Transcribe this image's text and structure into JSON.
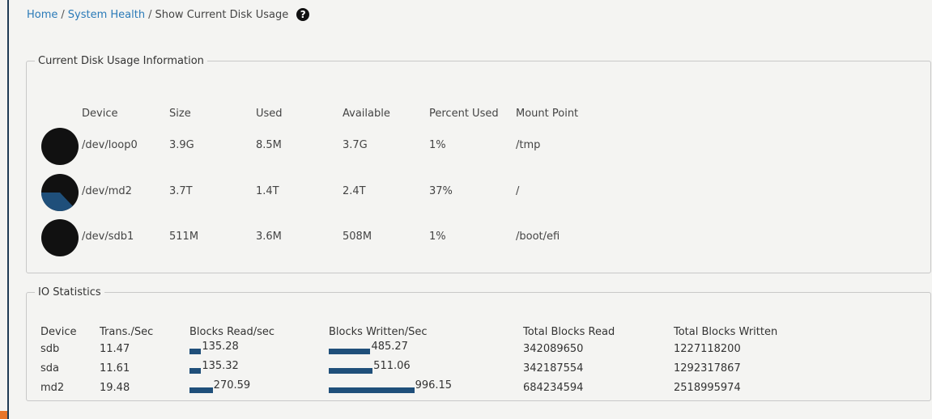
{
  "breadcrumb": {
    "home": "Home",
    "sep1": "/",
    "system_health": "System Health",
    "sep2": "/",
    "current": "Show Current Disk Usage",
    "help_glyph": "?"
  },
  "disk_usage": {
    "legend": "Current Disk Usage Information",
    "columns": [
      "Device",
      "Size",
      "Used",
      "Available",
      "Percent Used",
      "Mount Point"
    ],
    "rows": [
      {
        "device": "/dev/loop0",
        "size": "3.9G",
        "used": "8.5M",
        "available": "3.7G",
        "percent": "1%",
        "percent_value": 1,
        "mount": "/tmp"
      },
      {
        "device": "/dev/md2",
        "size": "3.7T",
        "used": "1.4T",
        "available": "2.4T",
        "percent": "37%",
        "percent_value": 37,
        "mount": "/"
      },
      {
        "device": "/dev/sdb1",
        "size": "511M",
        "used": "3.6M",
        "available": "508M",
        "percent": "1%",
        "percent_value": 1,
        "mount": "/boot/efi"
      }
    ]
  },
  "io_stats": {
    "legend": "IO Statistics",
    "columns": [
      "Device",
      "Trans./Sec",
      "Blocks Read/sec",
      "Blocks Written/Sec",
      "Total Blocks Read",
      "Total Blocks Written"
    ],
    "rows": [
      {
        "device": "sdb",
        "trans": "11.47",
        "read": "135.28",
        "written": "485.27",
        "total_read": "342089650",
        "total_written": "1227118200"
      },
      {
        "device": "sda",
        "trans": "11.61",
        "read": "135.32",
        "written": "511.06",
        "total_read": "342187554",
        "total_written": "1292317867"
      },
      {
        "device": "md2",
        "trans": "19.48",
        "read": "270.59",
        "written": "996.15",
        "total_read": "684234594",
        "total_written": "2518995974"
      }
    ]
  },
  "colors": {
    "pie_fill": "#111111",
    "pie_used": "#1f4f7a",
    "bar": "#1f4f7a",
    "link": "#2a7ab8"
  }
}
